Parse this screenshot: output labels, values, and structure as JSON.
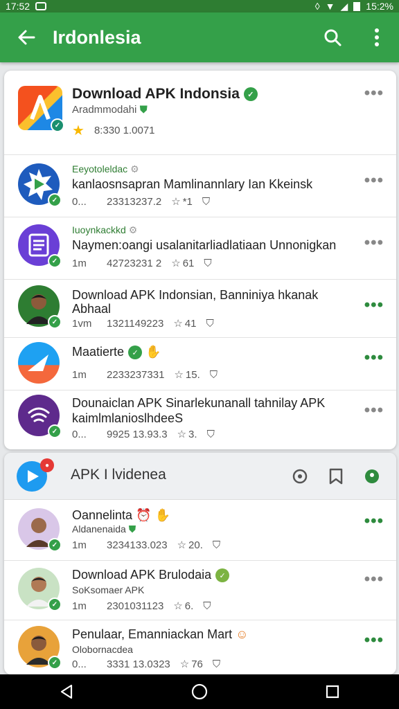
{
  "status_bar": {
    "time_left": "17:52",
    "time_right": "15:2%"
  },
  "app_bar": {
    "title": "Irdonlesia"
  },
  "featured": {
    "title": "Download APK Indonsia",
    "developer": "Aradmmodahi",
    "stats": "8:330  1.0071"
  },
  "list1": [
    {
      "name": "Eeyotoleldac",
      "desc": "kanlaosnsapran Mamlinannlary Ian Kkeinsk",
      "pre": "0...",
      "count": "23313237.2",
      "rating": "*1",
      "more_color": "gray"
    },
    {
      "name": "Iuoynkackkd",
      "desc": "Naymen:oangi usalanitarliadlatiaan Unnonigkan",
      "pre": "1m",
      "count": "42723231 2",
      "rating": "61",
      "more_color": "gray"
    },
    {
      "name": "Download APK Indonsian, Banniniya hkanak",
      "desc": "Abhaal",
      "pre": "1vm",
      "count": "1321149223",
      "rating": "41",
      "more_color": "green"
    },
    {
      "name": "Maatierte",
      "desc": "",
      "pre": "1m",
      "count": "2233237331",
      "rating": "15.",
      "more_color": "green"
    },
    {
      "name": "Dounaiclan APK Sinarlekunanall tahnilay APK",
      "desc": "kaimlmlanioslhdeeS",
      "pre": "0...",
      "count": "9925 13.93.3",
      "rating": "3.",
      "more_color": "gray"
    }
  ],
  "section2": {
    "header": "APK I lvidenea",
    "items": [
      {
        "name": "Oannelinta",
        "sub": "Aldanenaida",
        "pre": "1m",
        "count": "3234133.023",
        "rating": "20.",
        "more_color": "green"
      },
      {
        "name": "Download APK Brulodaia",
        "sub": "SoKsomaer APK",
        "pre": "1m",
        "count": "2301031123",
        "rating": "6.",
        "more_color": "gray"
      },
      {
        "name": "Penulaar, Emanniackan Mart",
        "sub": "Olobornacdea",
        "pre": "0...",
        "count": "3331 13.0323",
        "rating": "76",
        "more_color": "green"
      }
    ]
  },
  "icons": {
    "back": "arrow-left-icon",
    "search": "search-icon",
    "overflow": "more-vert-icon",
    "nav_back": "triangle-back-icon",
    "nav_home": "circle-home-icon",
    "nav_recents": "square-recents-icon"
  },
  "colors": {
    "app_bar": "#34a049",
    "status_bar": "#2e7d32",
    "accent_green": "#2e8b3e"
  }
}
